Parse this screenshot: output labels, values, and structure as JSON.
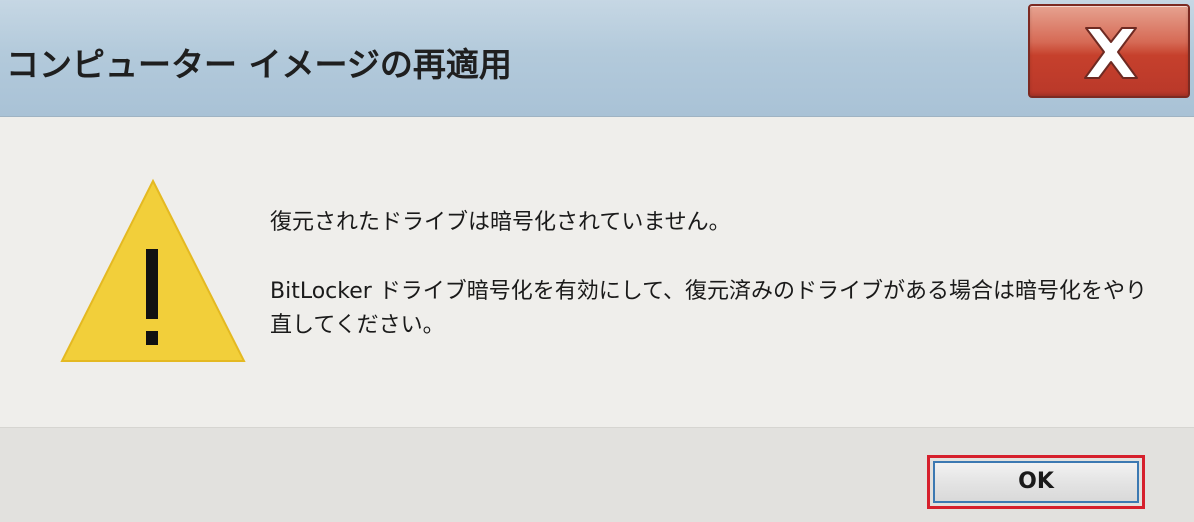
{
  "window": {
    "title": "コンピューター イメージの再適用",
    "close_icon": "close-icon"
  },
  "message": {
    "icon": "warning-icon",
    "line1": "復元されたドライブは暗号化されていません。",
    "line2": "BitLocker ドライブ暗号化を有効にして、復元済みのドライブがある場合は暗号化をやり直してください。"
  },
  "buttons": {
    "ok_label": "OK"
  },
  "colors": {
    "close_button": "#c6402c",
    "warning_fill": "#f2cf3a",
    "highlight": "#d6202c"
  }
}
